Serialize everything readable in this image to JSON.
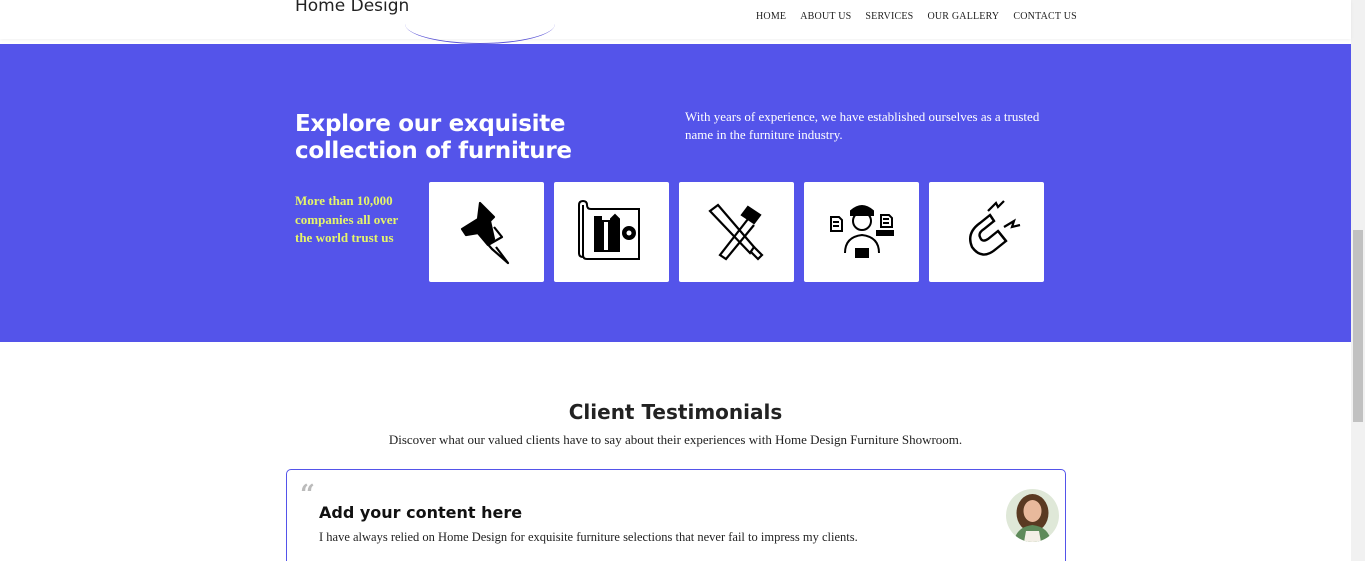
{
  "header": {
    "logo": "Home Design",
    "nav": [
      "HOME",
      "ABOUT US",
      "SERVICES",
      "OUR GALLERY",
      "CONTACT US"
    ]
  },
  "band": {
    "title": "Explore our exquisite collection of furniture",
    "description": "With years of experience, we have established ourselves as a trusted name in the furniture industry.",
    "trust": "More than 10,000 companies all over the world trust us",
    "icons": [
      "pushpin-icon",
      "blueprint-icon",
      "tools-icon",
      "designer-icon",
      "magnet-icon"
    ],
    "colors": {
      "background": "#5454ea",
      "trust_text": "#e5f56a"
    }
  },
  "testimonials": {
    "title": "Client Testimonials",
    "subtitle": "Discover what our valued clients have to say about their experiences with Home Design Furniture Showroom.",
    "items": [
      {
        "quote_mark": "“",
        "heading": "Add your content here",
        "text": "I have always relied on Home Design for exquisite furniture selections that never fail to impress my clients."
      }
    ]
  }
}
